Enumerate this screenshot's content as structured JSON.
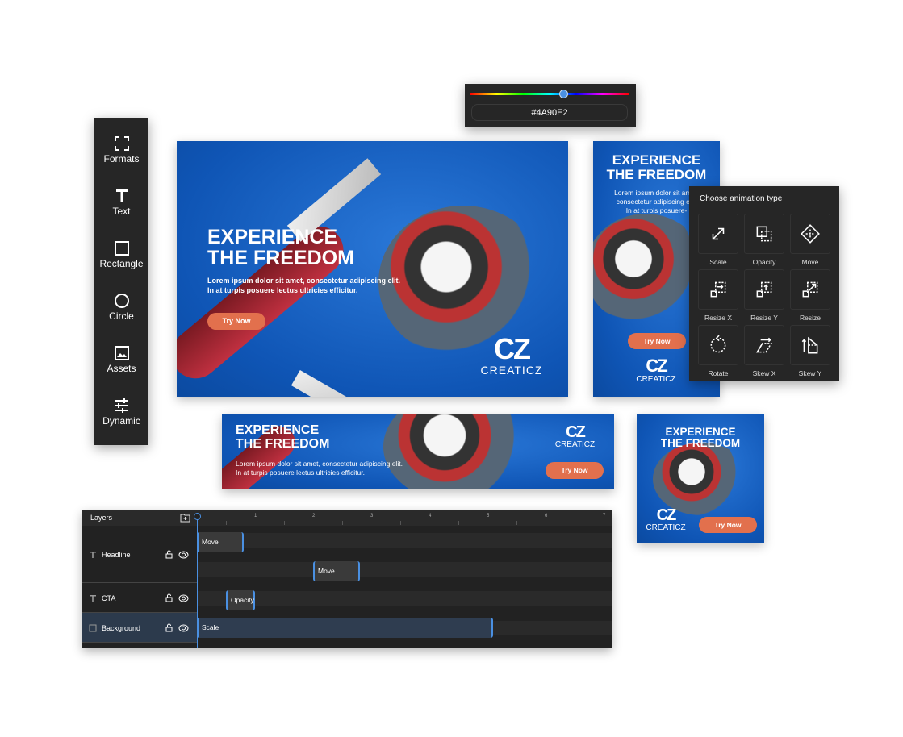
{
  "toolbar": {
    "items": [
      {
        "label": "Formats",
        "icon": "fullscreen-corners-icon"
      },
      {
        "label": "Text",
        "icon": "text-icon"
      },
      {
        "label": "Rectangle",
        "icon": "rectangle-icon"
      },
      {
        "label": "Circle",
        "icon": "circle-icon"
      },
      {
        "label": "Assets",
        "icon": "image-icon"
      },
      {
        "label": "Dynamic",
        "icon": "sliders-icon"
      }
    ]
  },
  "color_picker": {
    "hex": "#4A90E2",
    "hue_position": 0.59
  },
  "banner": {
    "headline1": "EXPERIENCE",
    "headline2": "THE FREEDOM",
    "body1": "Lorem ipsum dolor sit amet, consectetur adipiscing elit.",
    "body2": "In at turpis posuere lectus ultricies efficitur.",
    "tall_body1": "Lorem ipsum dolor sit amet,",
    "tall_body2": "consectetur adipiscing elit.",
    "tall_body3": "In at turpis posuere-",
    "cta": "Try Now",
    "logo_mark": "CZ",
    "logo_text": "CREATICZ"
  },
  "animation_panel": {
    "title": "Choose animation type",
    "types": [
      "Scale",
      "Opacity",
      "Move",
      "Resize X",
      "Resize Y",
      "Resize",
      "Rotate",
      "Skew X",
      "Skew Y"
    ]
  },
  "timeline": {
    "title": "Layers",
    "ticks": [
      "0",
      "1",
      "2",
      "3",
      "4",
      "5",
      "6",
      "7"
    ],
    "layers": [
      {
        "name": "Headline",
        "type": "text"
      },
      {
        "name": "CTA",
        "type": "text"
      },
      {
        "name": "Background",
        "type": "image",
        "selected": true
      }
    ],
    "clips": [
      {
        "layer": "Headline",
        "label": "Move",
        "start": 0,
        "end": 0.8
      },
      {
        "layer": "Headline",
        "label": "Move",
        "start": 2,
        "end": 2.8
      },
      {
        "layer": "CTA",
        "label": "Opacity",
        "start": 0.5,
        "end": 1.0
      },
      {
        "layer": "Background",
        "label": "Scale",
        "start": 0,
        "end": 5.1
      }
    ],
    "playhead": 0
  },
  "colors": {
    "accent": "#4A90E2",
    "cta": "#e2704d",
    "panel": "#262626",
    "banner_blue": "#1560c0"
  }
}
